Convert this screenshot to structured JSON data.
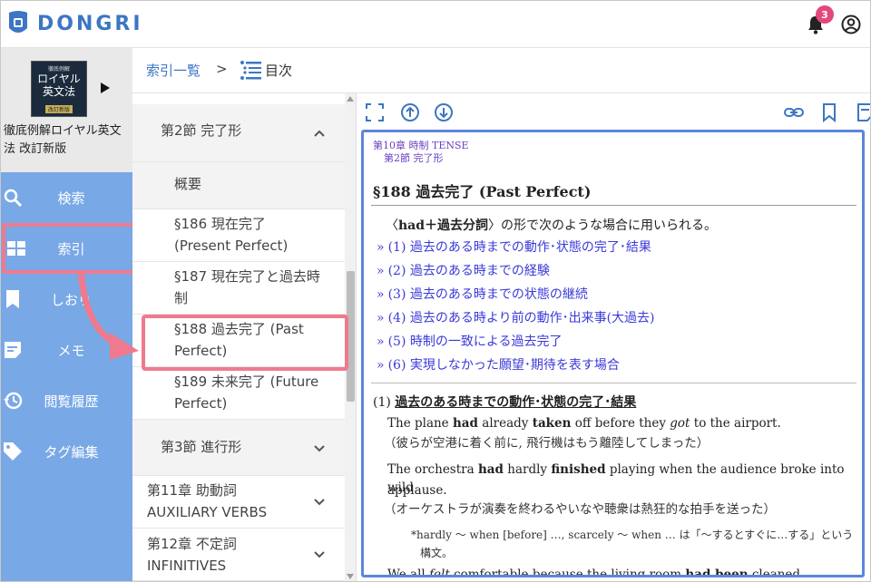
{
  "app": {
    "brand": "DONGRI",
    "notification_count": "3"
  },
  "book": {
    "cover_line1": "徹底例解",
    "cover_line2": "ロイヤル",
    "cover_line3": "英文法",
    "cover_line4": "改訂新版",
    "title": "徹底例解ロイヤル英文法 改訂新版"
  },
  "nav": {
    "items": [
      {
        "label": "検索",
        "icon": "search-icon"
      },
      {
        "label": "索引",
        "icon": "grid-icon"
      },
      {
        "label": "しおり",
        "icon": "bookmark-icon"
      },
      {
        "label": "メモ",
        "icon": "memo-icon"
      },
      {
        "label": "閲覧履歴",
        "icon": "history-icon"
      },
      {
        "label": "タグ編集",
        "icon": "tag-icon"
      }
    ]
  },
  "breadcrumb": {
    "index_list": "索引一覧",
    "separator": ">",
    "current": "目次"
  },
  "toc": {
    "rows": [
      {
        "label": "第2節 完了形"
      },
      {
        "label": "概要"
      },
      {
        "label_line1": "§186 現在完了",
        "label_line2": "(Present Perfect)"
      },
      {
        "label_line1": "§187 現在完了と過去時",
        "label_line2": "制"
      },
      {
        "label_line1": "§188 過去完了 (Past",
        "label_line2": "Perfect)"
      },
      {
        "label_line1": "§189 未来完了 (Future",
        "label_line2": "Perfect)"
      },
      {
        "label": "第3節 進行形"
      },
      {
        "label_line1": "第11章 助動詞",
        "label_line2": "AUXILIARY VERBS"
      },
      {
        "label_line1": "第12章 不定詞",
        "label_line2": "INFINITIVES"
      }
    ]
  },
  "content": {
    "chapter": "第10章 時制 TENSE",
    "section": "第2節 完了形",
    "heading": "§188 過去完了 (Past Perfect)",
    "intro_open": "〈",
    "intro_bold": "had＋過去分詞",
    "intro_rest": "〉の形で次のような場合に用いられる。",
    "links": [
      "(1) 過去のある時までの動作･状態の完了･結果",
      "(2) 過去のある時までの経験",
      "(3) 過去のある時までの状態の継続",
      "(4) 過去のある時より前の動作･出来事(大過去)",
      "(5) 時制の一致による過去完了",
      "(6) 実現しなかった願望･期待を表す場合"
    ],
    "link_marker": "»",
    "sub_num": "(1) ",
    "sub_title": "過去のある時までの動作･状態の完了･結果",
    "ex1_a": "The plane ",
    "ex1_b": "had",
    "ex1_c": " already ",
    "ex1_d": "taken",
    "ex1_e": " off before they ",
    "ex1_f": "got",
    "ex1_g": " to the airport.",
    "ex1_ja": "（彼らが空港に着く前に, 飛行機はもう離陸してしまった）",
    "ex2_a": "The orchestra ",
    "ex2_b": "had",
    "ex2_c": " hardly ",
    "ex2_d": "finished",
    "ex2_e": " playing when the audience broke into wild",
    "ex2_f": "applause.",
    "ex2_ja": "（オーケストラが演奏を終わるやいなや聴衆は熱狂的な拍手を送った）",
    "note_line1": "*hardly 〜 when [before] …, scarcely 〜 when … は「〜するとすぐに…する」という",
    "note_line2": "構文。",
    "ex3_a": "We all ",
    "ex3_b": "felt",
    "ex3_c": " comfortable because the living room ",
    "ex3_d": "had been",
    "ex3_e": " cleaned."
  }
}
